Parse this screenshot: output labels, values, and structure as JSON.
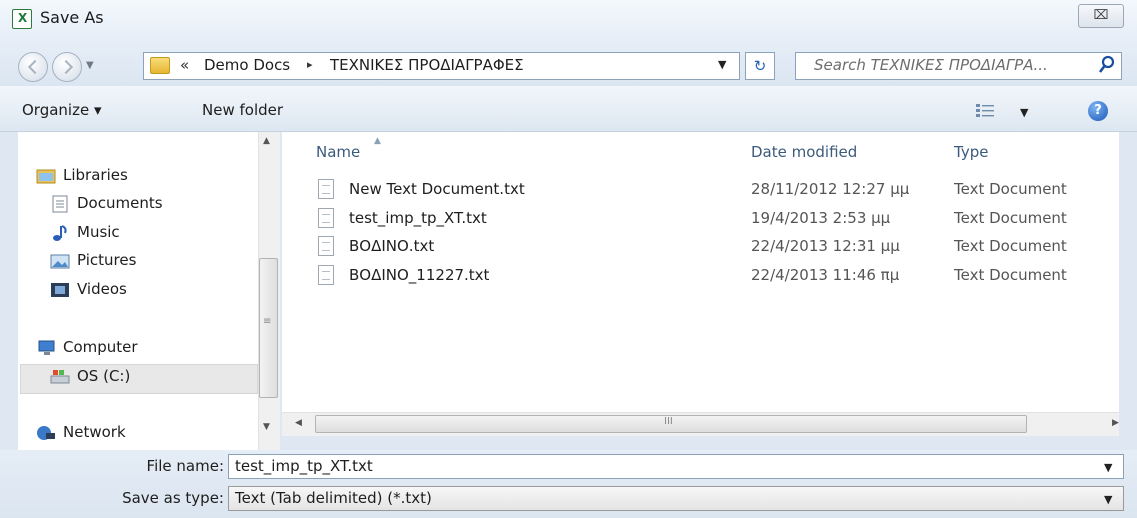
{
  "window": {
    "title": "Save As",
    "close_glyph": "⌧"
  },
  "address_bar": {
    "chevrons": "«",
    "crumbs": [
      "Demo Docs",
      "ΤΕΧΝΙΚΕΣ ΠΡΟΔΙΑΓΡΑΦΕΣ"
    ],
    "separator": "▸",
    "search_placeholder": "Search ΤΕΧΝΙΚΕΣ ΠΡΟΔΙΑΓΡΑ..."
  },
  "toolbar": {
    "organize_label": "Organize ▾",
    "new_folder_label": "New folder"
  },
  "nav_pane": {
    "items": [
      {
        "label": "Libraries",
        "icon": "libraries-icon"
      },
      {
        "label": "Documents",
        "icon": "documents-icon"
      },
      {
        "label": "Music",
        "icon": "music-icon"
      },
      {
        "label": "Pictures",
        "icon": "pictures-icon"
      },
      {
        "label": "Videos",
        "icon": "videos-icon"
      },
      {
        "label": "Computer",
        "icon": "computer-icon"
      },
      {
        "label": "OS (C:)",
        "icon": "drive-icon",
        "selected": true
      },
      {
        "label": "Network",
        "icon": "network-icon"
      }
    ]
  },
  "file_list": {
    "columns": [
      "Name",
      "Date modified",
      "Type"
    ],
    "rows": [
      {
        "name": "New Text Document.txt",
        "date": "28/11/2012 12:27 μμ",
        "type": "Text Document"
      },
      {
        "name": "test_imp_tp_XT.txt",
        "date": "19/4/2013 2:53 μμ",
        "type": "Text Document"
      },
      {
        "name": "ΒΟΔΙΝΟ.txt",
        "date": "22/4/2013 12:31 μμ",
        "type": "Text Document"
      },
      {
        "name": "ΒΟΔΙΝΟ_11227.txt",
        "date": "22/4/2013 11:46 πμ",
        "type": "Text Document"
      }
    ]
  },
  "form": {
    "file_name_label": "File name:",
    "file_name_value": "test_imp_tp_XT.txt",
    "save_type_label": "Save as type:",
    "save_type_value": "Text (Tab delimited) (*.txt)"
  },
  "colors": {
    "accent": "#2566b8",
    "column_header": "#3c5a7c"
  }
}
